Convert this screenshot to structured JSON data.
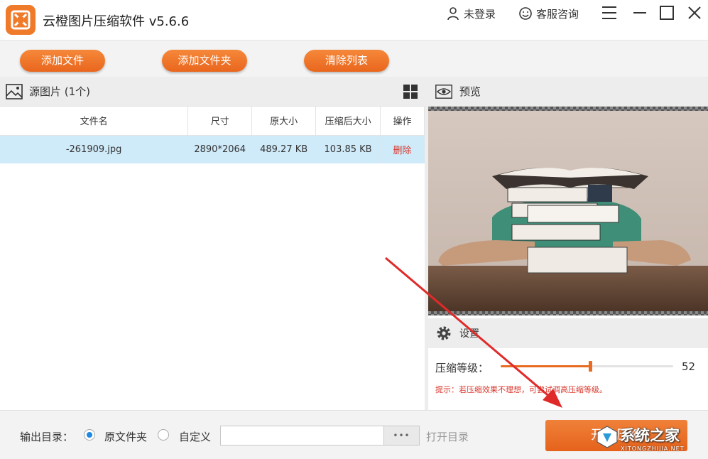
{
  "app": {
    "title": "云橙图片压缩软件 v5.6.6"
  },
  "titlebar": {
    "login": "未登录",
    "support": "客服咨询"
  },
  "toolbar": {
    "add_file": "添加文件",
    "add_folder": "添加文件夹",
    "clear_list": "清除列表"
  },
  "left_panel": {
    "title": "源图片 (1个)",
    "columns": [
      "文件名",
      "尺寸",
      "原大小",
      "压缩后大小",
      "操作"
    ],
    "rows": [
      {
        "name": "-261909.jpg",
        "size": "2890*2064",
        "original": "489.27 KB",
        "compressed": "103.85 KB",
        "action": "删除"
      }
    ]
  },
  "preview": {
    "title": "预览"
  },
  "settings": {
    "title": "设置",
    "level_label": "压缩等级：",
    "level_value": "52",
    "level_fraction": 0.52,
    "hint": "提示：若压缩效果不理想，可尝试调高压缩等级。"
  },
  "bottom": {
    "output_label": "输出目录：",
    "option_original": "原文件夹",
    "option_custom": "自定义",
    "path_value": "",
    "browse": "•••",
    "open_dir": "打开目录",
    "start": "开始压缩"
  },
  "watermark": {
    "text": "系统之家",
    "sub": "XITONGZHIJIA.NET"
  },
  "colors": {
    "accent": "#e9661d",
    "selected_row": "#cfeaf9",
    "danger": "#d9372d",
    "radio": "#1e88e5"
  }
}
